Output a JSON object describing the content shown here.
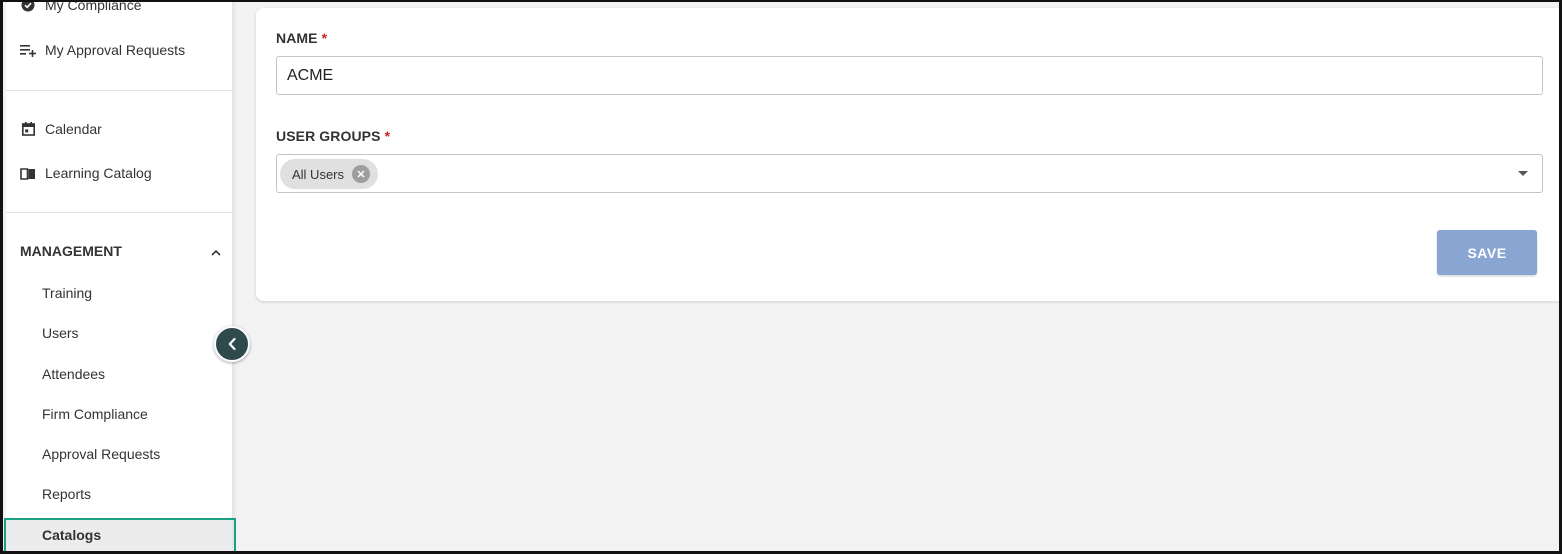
{
  "sidebar": {
    "top_items": [
      {
        "label": "My Compliance",
        "icon": "verified-check-icon"
      },
      {
        "label": "My Approval Requests",
        "icon": "playlist-add-icon"
      },
      {
        "label": "Calendar",
        "icon": "calendar-icon"
      },
      {
        "label": "Learning Catalog",
        "icon": "book-icon"
      }
    ],
    "management": {
      "title": "MANAGEMENT",
      "items": [
        {
          "label": "Training"
        },
        {
          "label": "Users"
        },
        {
          "label": "Attendees"
        },
        {
          "label": "Firm Compliance"
        },
        {
          "label": "Approval Requests"
        },
        {
          "label": "Reports"
        },
        {
          "label": "Catalogs",
          "active": true
        }
      ]
    }
  },
  "form": {
    "name_label": "NAME",
    "name_value": "ACME",
    "required_mark": "*",
    "groups_label": "USER GROUPS",
    "groups_selected": [
      "All Users"
    ],
    "save_label": "SAVE"
  },
  "colors": {
    "highlight": "#1aa183",
    "save_button": "#89a6d3",
    "collapse_button": "#2e4a4c",
    "required": "#c62828"
  }
}
